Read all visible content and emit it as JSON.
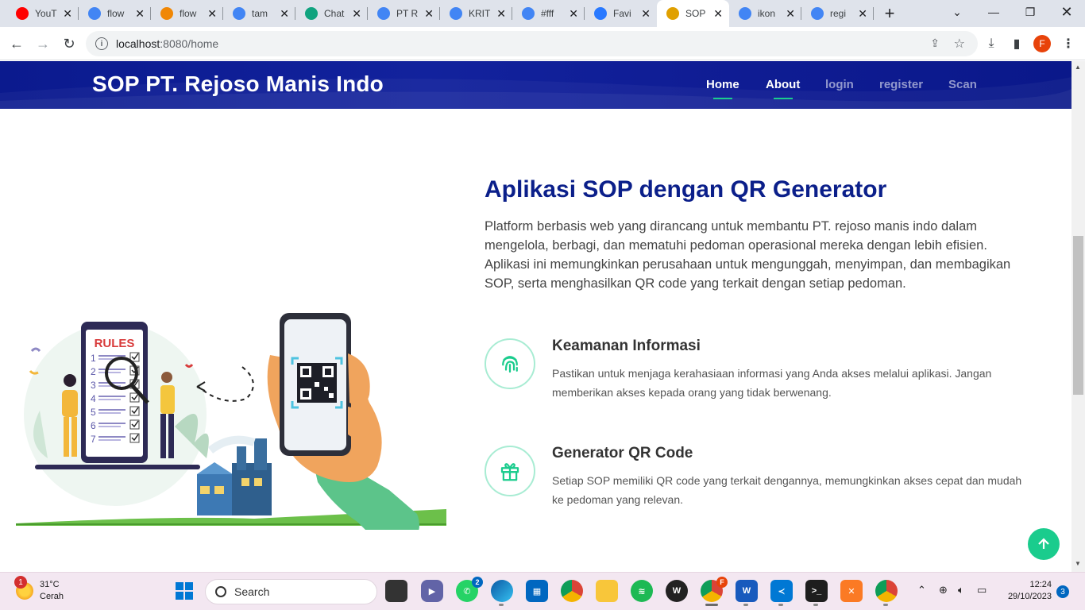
{
  "browser": {
    "tabs": [
      {
        "title": "YouT",
        "icon": "youtube-icon",
        "color": "#ff0000"
      },
      {
        "title": "flow",
        "icon": "google-icon",
        "color": "#4285f4"
      },
      {
        "title": "flow",
        "icon": "drawio-icon",
        "color": "#f08705"
      },
      {
        "title": "tam",
        "icon": "google-icon",
        "color": "#4285f4"
      },
      {
        "title": "Chat",
        "icon": "chatgpt-icon",
        "color": "#10a37f"
      },
      {
        "title": "PT R",
        "icon": "google-icon",
        "color": "#4285f4"
      },
      {
        "title": "KRIT",
        "icon": "google-icon",
        "color": "#4285f4"
      },
      {
        "title": "#fff",
        "icon": "google-icon",
        "color": "#4285f4"
      },
      {
        "title": "Favi",
        "icon": "favicon-io-icon",
        "color": "#2979ff"
      },
      {
        "title": "SOP",
        "icon": "sop-favicon-icon",
        "color": "#e0a000",
        "active": true
      },
      {
        "title": "ikon",
        "icon": "google-icon",
        "color": "#4285f4"
      },
      {
        "title": "regi",
        "icon": "google-icon",
        "color": "#4285f4"
      }
    ],
    "address": {
      "host": "localhost",
      "rest": ":8080/home"
    },
    "profile_initial": "F"
  },
  "site": {
    "brand": "SOP PT. Rejoso Manis Indo",
    "nav": [
      {
        "label": "Home",
        "active": true
      },
      {
        "label": "About",
        "active": true
      },
      {
        "label": "login",
        "active": false
      },
      {
        "label": "register",
        "active": false
      },
      {
        "label": "Scan",
        "active": false
      }
    ]
  },
  "about": {
    "title": "Aplikasi SOP dengan QR Generator",
    "lead": "Platform berbasis web yang dirancang untuk membantu PT. rejoso manis indo dalam mengelola, berbagi, dan mematuhi pedoman operasional mereka dengan lebih efisien. Aplikasi ini memungkinkan perusahaan untuk mengunggah, menyimpan, dan membagikan SOP, serta menghasilkan QR code yang terkait dengan setiap pedoman.",
    "illustration_rules_label": "RULES",
    "rule_numbers": [
      "1",
      "2",
      "3",
      "4",
      "5",
      "6",
      "7"
    ],
    "features": [
      {
        "title": "Keamanan Informasi",
        "text": "Pastikan untuk menjaga kerahasiaan informasi yang Anda akses melalui aplikasi. Jangan memberikan akses kepada orang yang tidak berwenang.",
        "icon": "fingerprint-icon"
      },
      {
        "title": "Generator QR Code",
        "text": "Setiap SOP memiliki QR code yang terkait dengannya, memungkinkan akses cepat dan mudah ke pedoman yang relevan.",
        "icon": "gift-icon"
      }
    ],
    "accent": "#1acc8d",
    "heading_color": "#0b1f8a"
  },
  "taskbar": {
    "weather": {
      "temp": "31°C",
      "cond": "Cerah",
      "badge": "1"
    },
    "search_placeholder": "Search",
    "time": "12:24",
    "date": "29/10/2023",
    "notifications": "3",
    "whatsapp_badge": "2"
  }
}
